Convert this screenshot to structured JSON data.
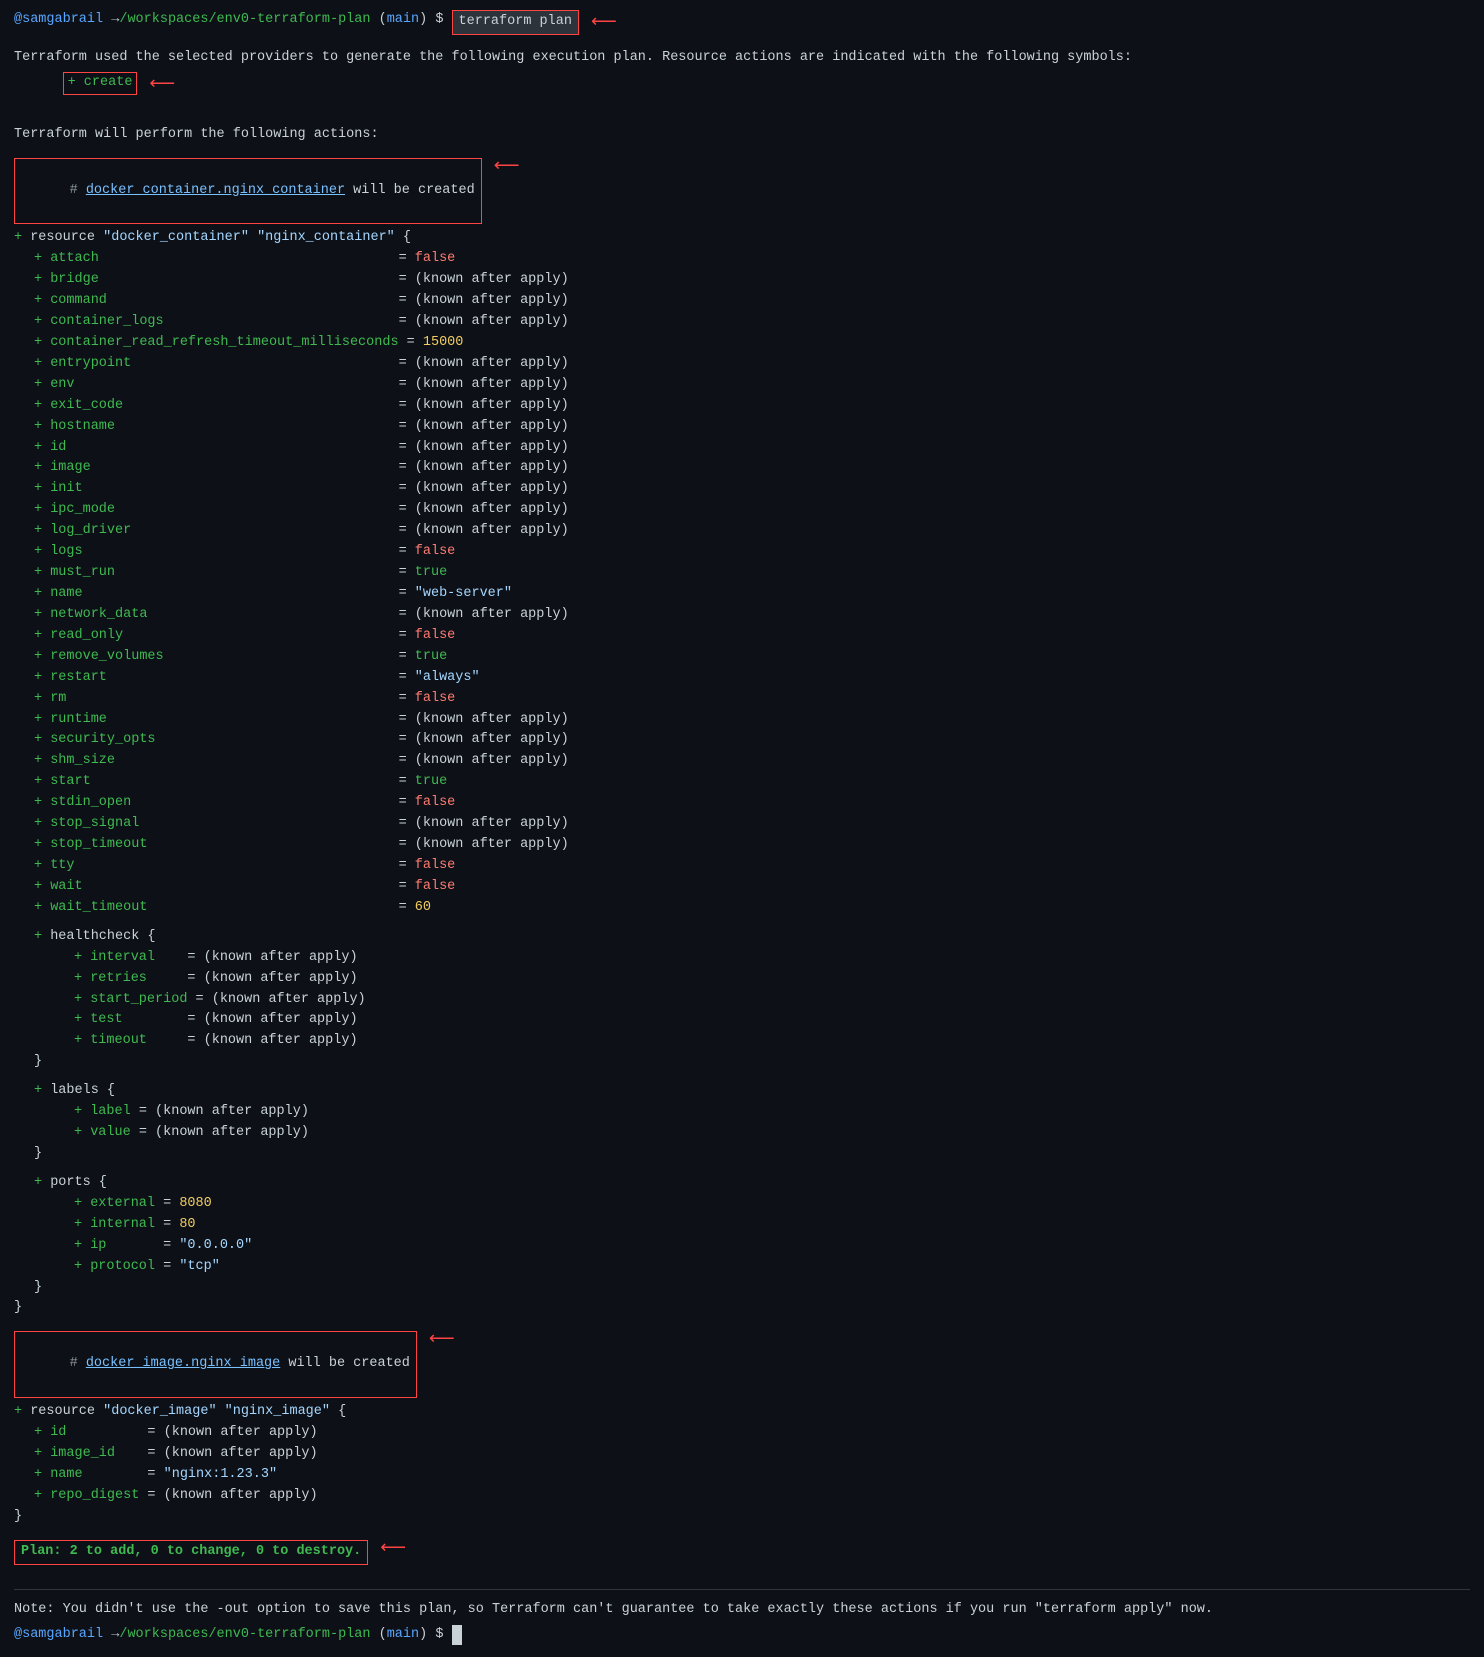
{
  "terminal": {
    "prompt1": {
      "user": "@samgabrail",
      "arrow": "→",
      "path": "/workspaces/env0-terraform-plan",
      "branch_open": "(",
      "branch": "main",
      "branch_close": ")",
      "symbol": "$",
      "command": "terraform plan"
    },
    "line1": "Terraform used the selected providers to generate the following execution plan. Resource actions are indicated with the following symbols:",
    "create_label": "+ create",
    "line2": "Terraform will perform the following actions:",
    "container_header": "# docker_container.nginx_container will be created",
    "resource_line": "+ resource \"docker_container\" \"nginx_container\" {",
    "attributes": [
      {
        "key": "attach",
        "eq": "=",
        "val": "false",
        "val_type": "bool_false"
      },
      {
        "key": "bridge",
        "eq": "=",
        "val": "(known after apply)",
        "val_type": "known"
      },
      {
        "key": "command",
        "eq": "=",
        "val": "(known after apply)",
        "val_type": "known"
      },
      {
        "key": "container_logs",
        "eq": "=",
        "val": "(known after apply)",
        "val_type": "known"
      },
      {
        "key": "container_read_refresh_timeout_milliseconds",
        "eq": "=",
        "val": "15000",
        "val_type": "number"
      },
      {
        "key": "entrypoint",
        "eq": "=",
        "val": "(known after apply)",
        "val_type": "known"
      },
      {
        "key": "env",
        "eq": "=",
        "val": "(known after apply)",
        "val_type": "known"
      },
      {
        "key": "exit_code",
        "eq": "=",
        "val": "(known after apply)",
        "val_type": "known"
      },
      {
        "key": "hostname",
        "eq": "=",
        "val": "(known after apply)",
        "val_type": "known"
      },
      {
        "key": "id",
        "eq": "=",
        "val": "(known after apply)",
        "val_type": "known"
      },
      {
        "key": "image",
        "eq": "=",
        "val": "(known after apply)",
        "val_type": "known"
      },
      {
        "key": "init",
        "eq": "=",
        "val": "(known after apply)",
        "val_type": "known"
      },
      {
        "key": "ipc_mode",
        "eq": "=",
        "val": "(known after apply)",
        "val_type": "known"
      },
      {
        "key": "log_driver",
        "eq": "=",
        "val": "(known after apply)",
        "val_type": "known"
      },
      {
        "key": "logs",
        "eq": "=",
        "val": "false",
        "val_type": "bool_false"
      },
      {
        "key": "must_run",
        "eq": "=",
        "val": "true",
        "val_type": "bool_true"
      },
      {
        "key": "name",
        "eq": "=",
        "val": "\"web-server\"",
        "val_type": "string"
      },
      {
        "key": "network_data",
        "eq": "=",
        "val": "(known after apply)",
        "val_type": "known"
      },
      {
        "key": "read_only",
        "eq": "=",
        "val": "false",
        "val_type": "bool_false"
      },
      {
        "key": "remove_volumes",
        "eq": "=",
        "val": "true",
        "val_type": "bool_true"
      },
      {
        "key": "restart",
        "eq": "=",
        "val": "\"always\"",
        "val_type": "string"
      },
      {
        "key": "rm",
        "eq": "=",
        "val": "false",
        "val_type": "bool_false"
      },
      {
        "key": "runtime",
        "eq": "=",
        "val": "(known after apply)",
        "val_type": "known"
      },
      {
        "key": "security_opts",
        "eq": "=",
        "val": "(known after apply)",
        "val_type": "known"
      },
      {
        "key": "shm_size",
        "eq": "=",
        "val": "(known after apply)",
        "val_type": "known"
      },
      {
        "key": "start",
        "eq": "=",
        "val": "true",
        "val_type": "bool_true"
      },
      {
        "key": "stdin_open",
        "eq": "=",
        "val": "false",
        "val_type": "bool_false"
      },
      {
        "key": "stop_signal",
        "eq": "=",
        "val": "(known after apply)",
        "val_type": "known"
      },
      {
        "key": "stop_timeout",
        "eq": "=",
        "val": "(known after apply)",
        "val_type": "known"
      },
      {
        "key": "tty",
        "eq": "=",
        "val": "false",
        "val_type": "bool_false"
      },
      {
        "key": "wait",
        "eq": "=",
        "val": "false",
        "val_type": "bool_false"
      },
      {
        "key": "wait_timeout",
        "eq": "=",
        "val": "60",
        "val_type": "number"
      }
    ],
    "healthcheck_block": {
      "header": "+ healthcheck {",
      "fields": [
        {
          "key": "interval",
          "eq": "=",
          "val": "(known after apply)"
        },
        {
          "key": "retries",
          "eq": "=",
          "val": "(known after apply)"
        },
        {
          "key": "start_period",
          "eq": "=",
          "val": "(known after apply)"
        },
        {
          "key": "test",
          "eq": "=",
          "val": "(known after apply)"
        },
        {
          "key": "timeout",
          "eq": "=",
          "val": "(known after apply)"
        }
      ]
    },
    "labels_block": {
      "header": "+ labels {",
      "fields": [
        {
          "key": "label",
          "eq": "=",
          "val": "(known after apply)"
        },
        {
          "key": "value",
          "eq": "=",
          "val": "(known after apply)"
        }
      ]
    },
    "ports_block": {
      "header": "+ ports {",
      "fields": [
        {
          "key": "external",
          "eq": "=",
          "val": "8080",
          "val_type": "number"
        },
        {
          "key": "internal",
          "eq": "=",
          "val": "80",
          "val_type": "number"
        },
        {
          "key": "ip",
          "eq": "=",
          "val": "\"0.0.0.0\"",
          "val_type": "string"
        },
        {
          "key": "protocol",
          "eq": "=",
          "val": "\"tcp\"",
          "val_type": "string"
        }
      ]
    },
    "image_header": "# docker_image.nginx_image will be created",
    "image_resource_line": "+ resource \"docker_image\" \"nginx_image\" {",
    "image_attributes": [
      {
        "key": "id",
        "eq": "=",
        "val": "(known after apply)",
        "val_type": "known"
      },
      {
        "key": "image_id",
        "eq": "=",
        "val": "(known after apply)",
        "val_type": "known"
      },
      {
        "key": "name",
        "eq": "=",
        "val": "\"nginx:1.23.3\"",
        "val_type": "string"
      },
      {
        "key": "repo_digest",
        "eq": "=",
        "val": "(known after apply)",
        "val_type": "known"
      }
    ],
    "plan_summary": "Plan: 2 to add, 0 to change, 0 to destroy.",
    "note": "Note: You didn't use the -out option to save this plan, so Terraform can't guarantee to take exactly these actions if you run \"terraform apply\" now.",
    "prompt2": {
      "user": "@samgabrail",
      "arrow": "→",
      "path": "/workspaces/env0-terraform-plan",
      "branch_open": "(",
      "branch": "main",
      "branch_close": ")",
      "symbol": "$"
    }
  }
}
